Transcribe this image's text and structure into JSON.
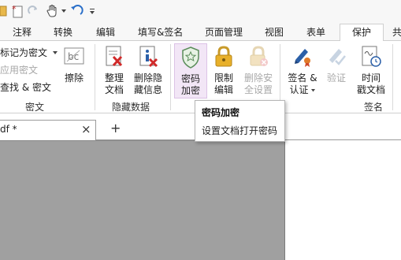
{
  "tabs": [
    "注释",
    "转换",
    "编辑",
    "填写&签名",
    "页面管理",
    "视图",
    "表单",
    "保护",
    "共"
  ],
  "active_tab": "保护",
  "ribbon": {
    "mark_redaction": "标记为密文",
    "apply_redaction": "应用密文",
    "find_redact": "查找 & 密文",
    "erase": "擦除",
    "group_redaction": "密文",
    "sanitize_line1": "整理",
    "sanitize_line2": "文档",
    "remove_hidden_line1": "删除隐",
    "remove_hidden_line2": "藏信息",
    "group_hidden": "隐藏数据",
    "password_line1": "密码",
    "password_line2": "加密",
    "restrict_line1": "限制",
    "restrict_line2": "编辑",
    "remove_security_line1": "删除安",
    "remove_security_line2": "全设置",
    "sign_line1": "签名 &",
    "sign_line2": "认证",
    "validate": "验证",
    "timestamp_line1": "时间",
    "timestamp_line2": "戳文档",
    "group_sign": "签名"
  },
  "document_tab": {
    "name": "df *",
    "close": "×",
    "new_tab": "+"
  },
  "tooltip": {
    "title": "密码加密",
    "description": "设置文档打开密码"
  },
  "colors": {
    "tab_active_border": "#cfcfcf",
    "highlight_bg": "#f2e6f6",
    "workspace_bg": "#a0a0a0",
    "disabled_text": "#a8a8a8"
  }
}
